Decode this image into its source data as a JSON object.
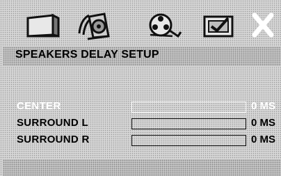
{
  "toolbar": {
    "icons": [
      {
        "name": "display-setup-icon"
      },
      {
        "name": "audio-setup-icon"
      },
      {
        "name": "video-setup-icon"
      },
      {
        "name": "preferences-icon"
      },
      {
        "name": "exit-icon"
      }
    ]
  },
  "menu": {
    "title": "SPEAKERS DELAY SETUP",
    "rows": [
      {
        "label": "CENTER",
        "value": "0 MS",
        "level": 0,
        "highlighted": true
      },
      {
        "label": "SURROUND L",
        "value": "0 MS",
        "level": 0,
        "highlighted": false
      },
      {
        "label": "SURROUND R",
        "value": "0 MS",
        "level": 0,
        "highlighted": false
      }
    ]
  },
  "colors": {
    "background": "#d6d6d6",
    "text": "#000000",
    "highlight_text": "#ffffff"
  }
}
